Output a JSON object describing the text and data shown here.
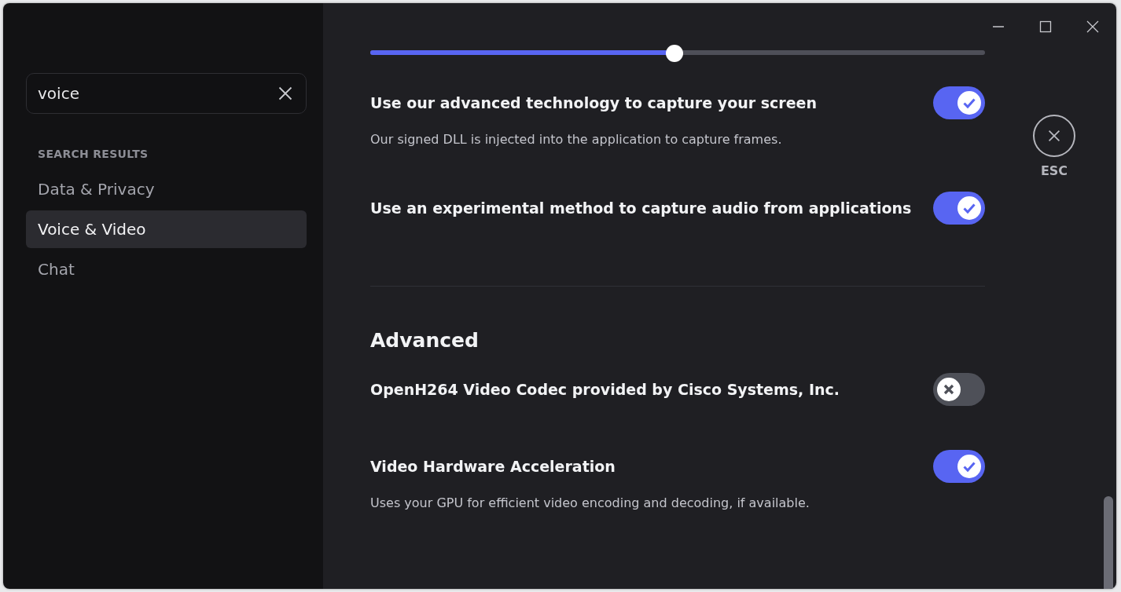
{
  "sidebar": {
    "search": {
      "value": "voice"
    },
    "section_title": "SEARCH RESULTS",
    "items": [
      {
        "label": "Data & Privacy",
        "selected": false
      },
      {
        "label": "Voice & Video",
        "selected": true
      },
      {
        "label": "Chat",
        "selected": false
      }
    ]
  },
  "content": {
    "slider": {
      "level": 0.495
    },
    "settings": [
      {
        "title": "Use our advanced technology to capture your screen",
        "description": "Our signed DLL is injected into the application to capture frames.",
        "on": true
      },
      {
        "title": "Use an experimental method to capture audio from applications",
        "on": true
      }
    ],
    "advanced": {
      "title": "Advanced",
      "settings": [
        {
          "title": "OpenH264 Video Codec provided by Cisco Systems, Inc.",
          "on": false
        },
        {
          "title": "Video Hardware Acceleration",
          "description": "Uses your GPU for efficient video encoding and decoding, if available.",
          "on": true
        }
      ]
    }
  },
  "close": {
    "label": "ESC"
  }
}
